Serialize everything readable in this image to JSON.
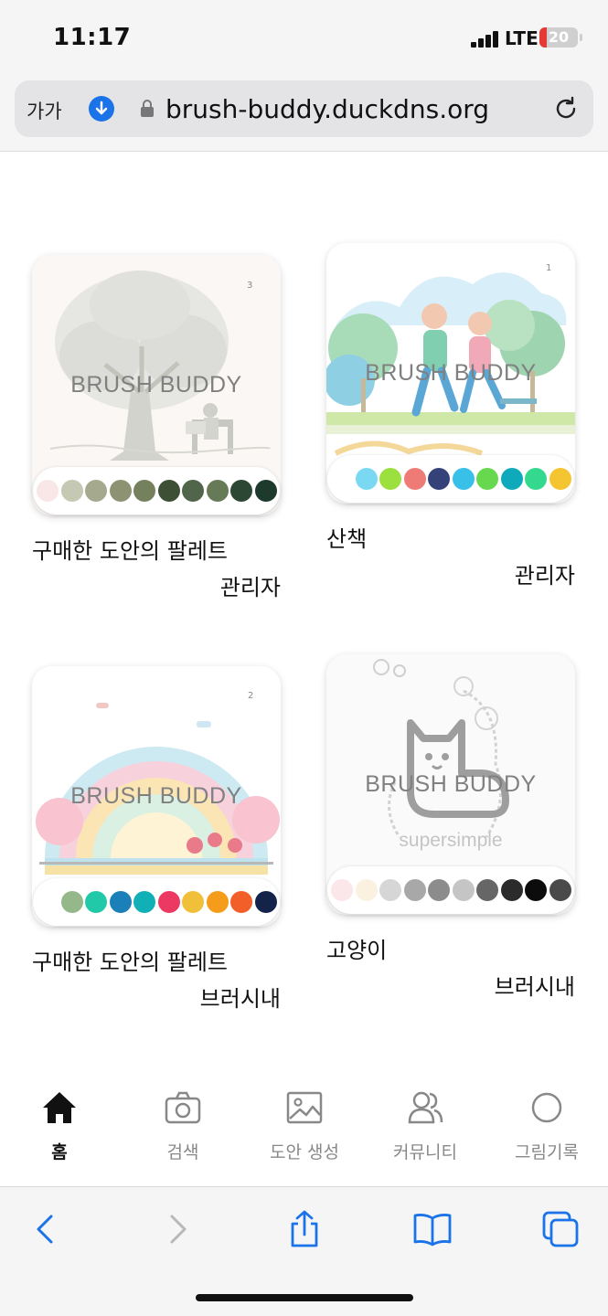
{
  "status": {
    "time": "11:17",
    "network": "LTE",
    "battery": "20",
    "battery_level": 0.2
  },
  "browser": {
    "text_size_label": "가가",
    "url": "brush-buddy.duckdns.org",
    "icons": [
      "download-icon",
      "lock-icon",
      "reload-icon",
      "back-icon",
      "forward-icon",
      "share-icon",
      "bookmarks-icon",
      "tabs-icon"
    ]
  },
  "watermark": "BRUSH BUDDY",
  "cards": [
    {
      "title": "구매한 도안의 팔레트",
      "author": "관리자",
      "number_tag": "3",
      "palette": [
        "#f9e7e7",
        "#c5c9b3",
        "#a5aa8e",
        "#8d9372",
        "#75805d",
        "#3d4f35",
        "#51654a",
        "#677a58",
        "#2c4733",
        "#1d3a2d"
      ]
    },
    {
      "title": "산책",
      "author": "관리자",
      "number_tag": "1",
      "palette": [
        "#ffffff",
        "#7ad8f2",
        "#9be03e",
        "#ef7b76",
        "#35427a",
        "#38c0e8",
        "#68d94e",
        "#0eaabc",
        "#34d98f",
        "#f5c531"
      ]
    },
    {
      "title": "구매한 도안의 팔레트",
      "author": "브러시내",
      "number_tag": "2",
      "palette": [
        "#ffffff",
        "#95b88a",
        "#22c9a8",
        "#1b7fb8",
        "#11b0b7",
        "#ec3964",
        "#f1c03a",
        "#f59c1a",
        "#f25f28",
        "#14234a"
      ]
    },
    {
      "title": "고양이",
      "author": "브러시내",
      "number_tag": "",
      "image_text": "supersimple",
      "palette": [
        "#fbe6ea",
        "#fbf1e0",
        "#d6d6d6",
        "#a8a8a8",
        "#8c8c8c",
        "#c5c5c5",
        "#666666",
        "#2b2b2b",
        "#0c0c0c",
        "#4a4a4a"
      ]
    }
  ],
  "tabs": [
    {
      "label": "홈",
      "icon": "home-icon",
      "active": true
    },
    {
      "label": "검색",
      "icon": "camera-icon",
      "active": false
    },
    {
      "label": "도안 생성",
      "icon": "image-icon",
      "active": false
    },
    {
      "label": "커뮤니티",
      "icon": "people-icon",
      "active": false
    },
    {
      "label": "그림기록",
      "icon": "circle-icon",
      "active": false
    }
  ]
}
